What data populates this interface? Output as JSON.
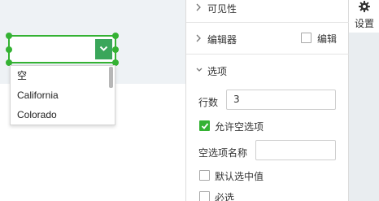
{
  "dropdown": {
    "options": [
      "空",
      "California",
      "Colorado"
    ]
  },
  "panel": {
    "visibility": {
      "label": "可见性"
    },
    "editor": {
      "label": "编辑器",
      "checkbox_label": "编辑",
      "checked": false
    },
    "options": {
      "label": "选项",
      "rows_label": "行数",
      "rows_value": "3",
      "allow_empty_label": "允许空选项",
      "allow_empty_checked": true,
      "empty_name_label": "空选项名称",
      "empty_name_value": "",
      "default_select_label": "默认选中值",
      "default_select_checked": false,
      "required_label": "必选",
      "required_checked": false
    }
  },
  "strip": {
    "settings_label": "设置",
    "settings_icon": "gear-icon"
  },
  "colors": {
    "accent": "#34b233",
    "dropdown_arrow_bg": "#3aa65a",
    "canvas_band": "#eef2f5",
    "strip_bg": "#e9edf0"
  }
}
